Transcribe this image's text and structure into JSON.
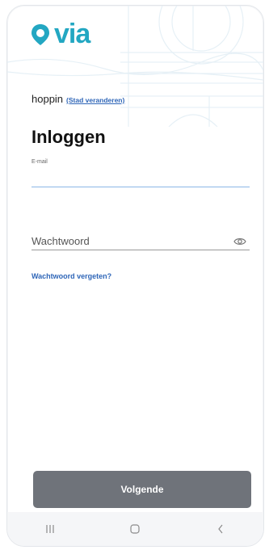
{
  "brand": {
    "logo_text": "via",
    "color": "#23a7c2"
  },
  "city": {
    "name": "hoppin",
    "change_link": "(Stad veranderen)"
  },
  "login": {
    "title": "Inloggen",
    "email_label": "E-mail",
    "email_value": "",
    "password_placeholder": "Wachtwoord",
    "password_value": "",
    "forgot_link": "Wachtwoord vergeten?",
    "next_button": "Volgende"
  },
  "navbar": {
    "recent_icon": "recent-apps-icon",
    "home_icon": "home-icon",
    "back_icon": "back-icon"
  },
  "colors": {
    "link": "#2f66b8",
    "button_bg": "#6f737a",
    "active_underline": "#8bb7e6"
  }
}
